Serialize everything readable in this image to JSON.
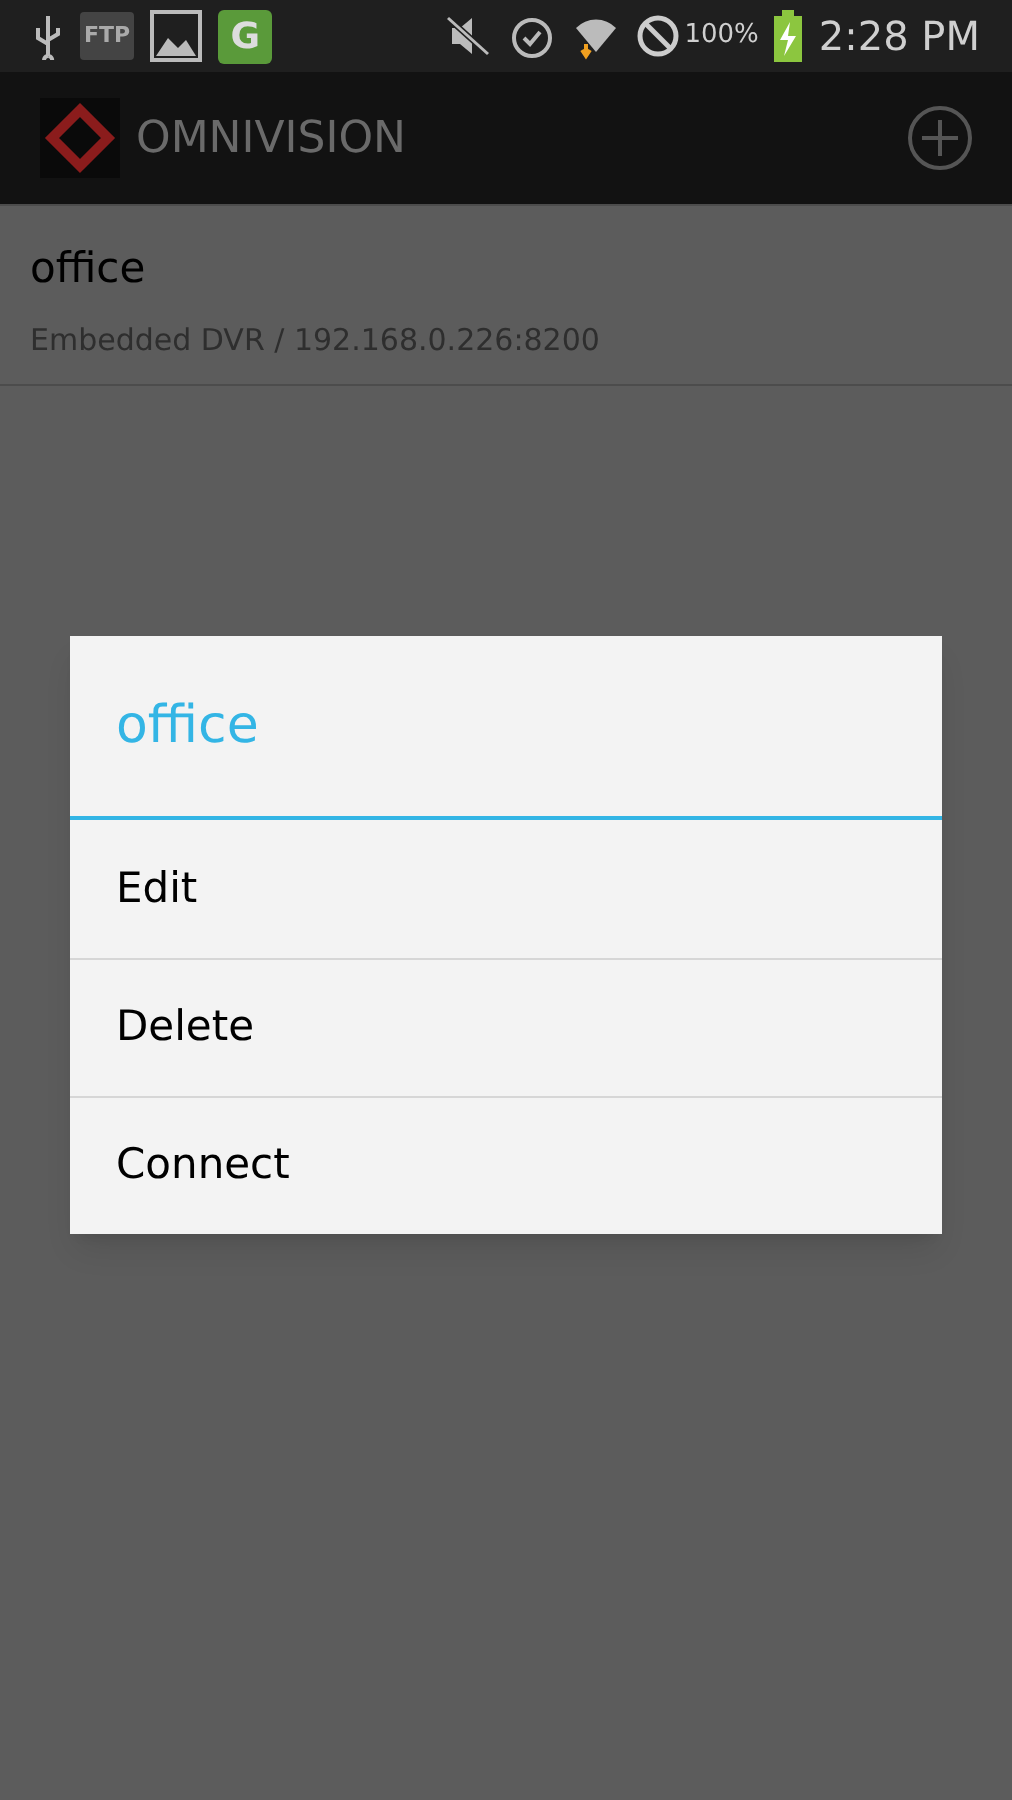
{
  "status_bar": {
    "ftp_label": "FTP",
    "app_letter": "G",
    "battery_percent": "100%",
    "time": "2:28 PM"
  },
  "app_bar": {
    "title": "OMNIVISION"
  },
  "devices": [
    {
      "name": "office",
      "detail": "Embedded DVR / 192.168.0.226:8200"
    }
  ],
  "dialog": {
    "title": "office",
    "items": [
      {
        "label": "Edit"
      },
      {
        "label": "Delete"
      },
      {
        "label": "Connect"
      }
    ]
  }
}
